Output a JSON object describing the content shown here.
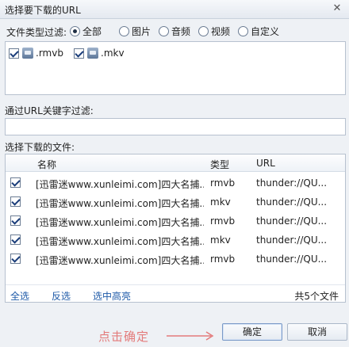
{
  "window": {
    "title": "选择要下载的URL",
    "close_label": "✕"
  },
  "filetype_filter": {
    "label": "文件类型过滤:",
    "options": [
      {
        "label": "全部",
        "selected": true
      },
      {
        "label": "图片",
        "selected": false
      },
      {
        "label": "音频",
        "selected": false
      },
      {
        "label": "视频",
        "selected": false
      },
      {
        "label": "自定义",
        "selected": false
      }
    ],
    "types": [
      {
        "label": ".rmvb",
        "checked": true,
        "icon": "video-file-icon"
      },
      {
        "label": ".mkv",
        "checked": true,
        "icon": "video-file-icon"
      }
    ]
  },
  "keyword_filter": {
    "label": "通过URL关键字过滤:",
    "value": "",
    "placeholder": ""
  },
  "downloads": {
    "label": "选择下载的文件:",
    "columns": {
      "name": "名称",
      "type": "类型",
      "url": "URL"
    },
    "rows": [
      {
        "checked": true,
        "name": "[迅雷迷www.xunleimi.com]四大名捕...",
        "type": "rmvb",
        "url": "thunder://QU..."
      },
      {
        "checked": true,
        "name": "[迅雷迷www.xunleimi.com]四大名捕...",
        "type": "mkv",
        "url": "thunder://QU..."
      },
      {
        "checked": true,
        "name": "[迅雷迷www.xunleimi.com]四大名捕...",
        "type": "rmvb",
        "url": "thunder://QU..."
      },
      {
        "checked": true,
        "name": "[迅雷迷www.xunleimi.com]四大名捕...",
        "type": "mkv",
        "url": "thunder://QU..."
      },
      {
        "checked": true,
        "name": "[迅雷迷www.xunleimi.com]四大名捕...",
        "type": "rmvb",
        "url": "thunder://QU..."
      }
    ],
    "select_all": "全选",
    "invert": "反选",
    "select_highlighted": "选中高亮",
    "count": "共5个文件"
  },
  "footer": {
    "hint": "点击确定",
    "ok": "确定",
    "cancel": "取消"
  },
  "colors": {
    "link": "#1e5aa8",
    "hint": "#e37b7b",
    "panel_bg": "#eef1f5"
  }
}
